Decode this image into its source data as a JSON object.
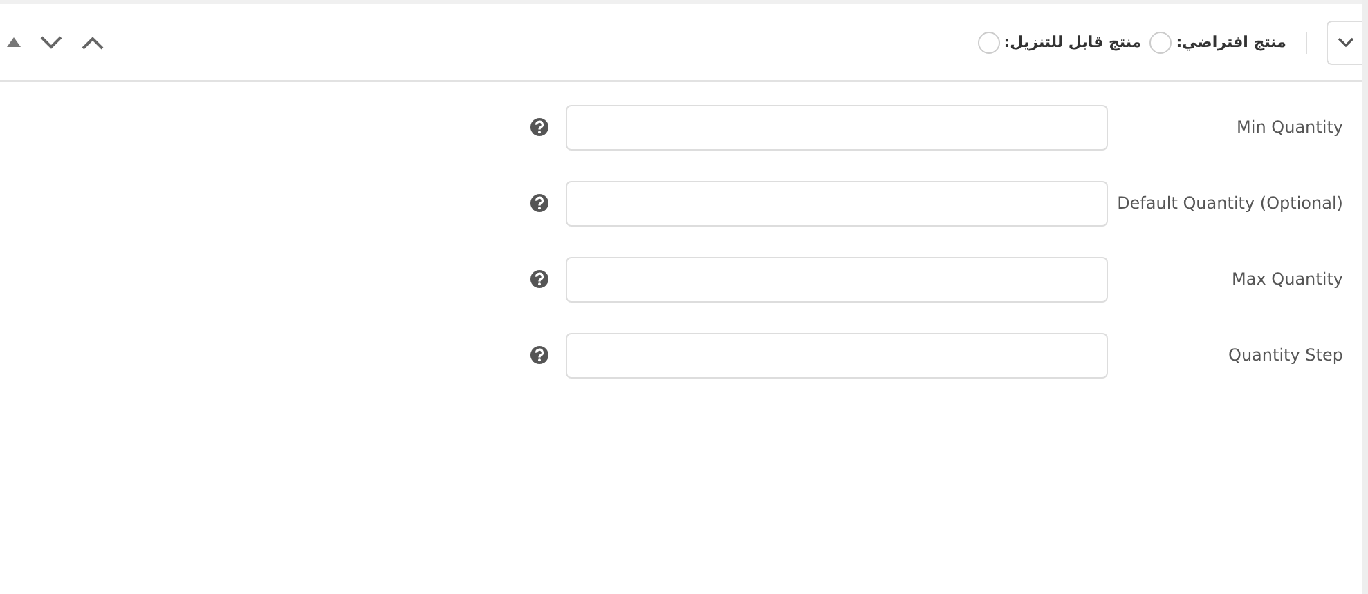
{
  "header": {
    "options": [
      {
        "label": "منتج افتراضي:",
        "checked": false
      },
      {
        "label": "منتج قابل للتنزيل:",
        "checked": false
      }
    ]
  },
  "fields": [
    {
      "label": "Min Quantity"
    },
    {
      "label": "Default Quantity (Optional)"
    },
    {
      "label": "Max Quantity"
    },
    {
      "label": "Quantity Step"
    }
  ]
}
